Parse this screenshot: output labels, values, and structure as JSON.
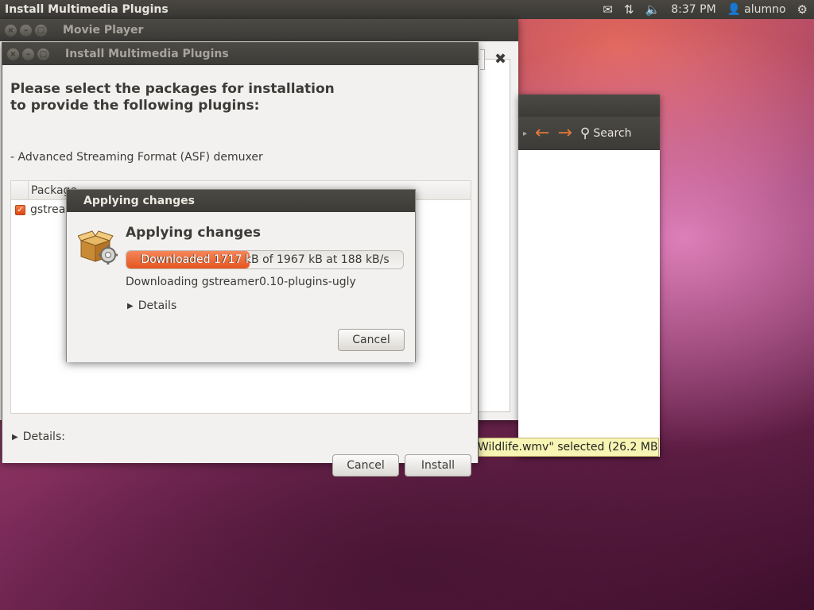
{
  "top_panel": {
    "app_title": "Install Multimedia Plugins",
    "clock": "8:37 PM",
    "user": "alumno",
    "icons": [
      "mail-icon",
      "network-icon",
      "volume-icon",
      "user-icon",
      "gear-icon"
    ]
  },
  "movie_player": {
    "title": "Movie Player"
  },
  "file_chooser": {
    "search_label": "Search",
    "status_text": "Wildlife.wmv\" selected (26.2 MB)"
  },
  "install_dialog": {
    "title": "Install Multimedia Plugins",
    "heading_line1": "Please select the packages for installation",
    "heading_line2": "to provide the following plugins:",
    "plugins": [
      "- Advanced Streaming Format (ASF) demuxer"
    ],
    "column_header": "Package",
    "packages": [
      {
        "name": "gstreamer0.10-plugins-ugly",
        "checked": true
      }
    ],
    "details_label": "Details:",
    "cancel_label": "Cancel",
    "install_label": "Install"
  },
  "apply_dialog": {
    "title": "Applying changes",
    "heading": "Applying changes",
    "progress_text": "Downloaded 1717 kB of 1967 kB at 188 kB/s",
    "progress_fraction": 0.446,
    "status": "Downloading gstreamer0.10-plugins-ugly",
    "details_label": "Details",
    "cancel_label": "Cancel"
  },
  "colors": {
    "accent": "#dd4814",
    "tooltip_bg": "#f8f5b4",
    "panel_bg": "#3c3b37"
  }
}
